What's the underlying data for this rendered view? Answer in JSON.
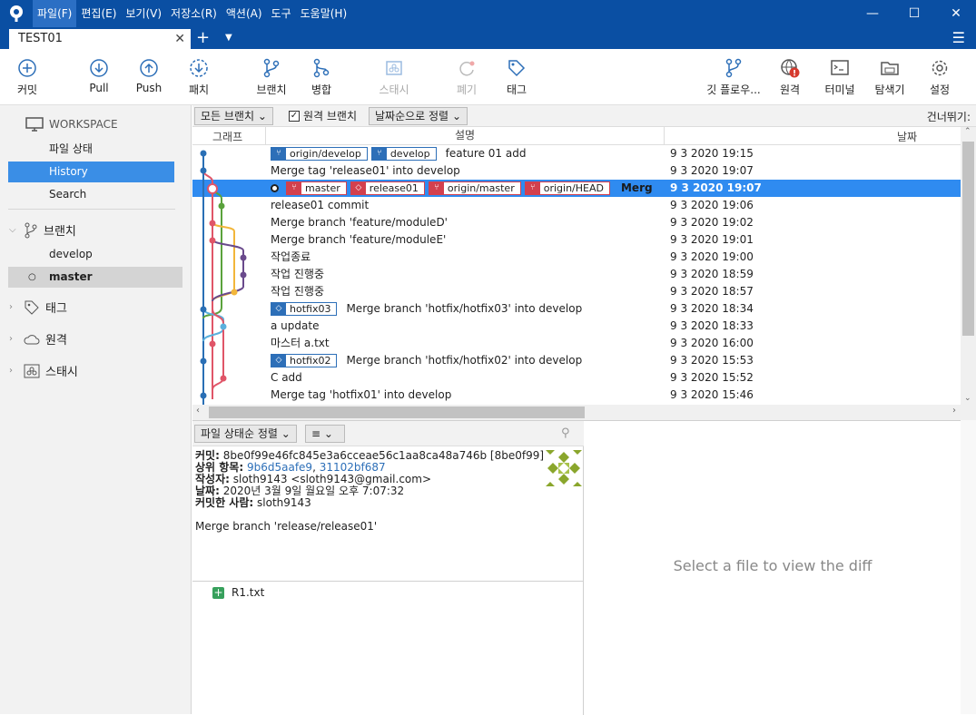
{
  "menu": {
    "items": [
      "파일(F)",
      "편집(E)",
      "보기(V)",
      "저장소(R)",
      "액션(A)",
      "도구",
      "도움말(H)"
    ]
  },
  "tab": {
    "title": "TEST01"
  },
  "toolbar": {
    "commit": "커밋",
    "pull": "Pull",
    "push": "Push",
    "fetch": "패치",
    "branch": "브랜치",
    "merge": "병합",
    "stash": "스태시",
    "discard": "폐기",
    "tag": "태그",
    "gitflow": "깃 플로우...",
    "remote": "원격",
    "terminal": "터미널",
    "explorer": "탐색기",
    "settings": "설정"
  },
  "sidebar": {
    "workspace": "WORKSPACE",
    "file_status": "파일 상태",
    "history": "History",
    "search": "Search",
    "branches": "브랜치",
    "branch_items": [
      "develop",
      "master"
    ],
    "tags": "태그",
    "remotes": "원격",
    "stashes": "스태시"
  },
  "filter": {
    "all_branches": "모든 브랜치",
    "remote_branches": "원격 브랜치",
    "sort": "날짜순으로 정렬",
    "skip": "건너뛰기:"
  },
  "columns": {
    "graph": "그래프",
    "desc": "설명",
    "date": "날짜"
  },
  "commits": [
    {
      "badges": [
        {
          "label": "origin/develop",
          "type": "branch",
          "color": "blue"
        },
        {
          "label": "develop",
          "type": "branch",
          "color": "blue"
        }
      ],
      "msg": "feature 01 add",
      "date": "9 3 2020 19:15"
    },
    {
      "badges": [],
      "msg": "Merge tag 'release01' into develop",
      "date": "9 3 2020 19:07"
    },
    {
      "badges": [
        {
          "label": "master",
          "type": "branch",
          "color": "red"
        },
        {
          "label": "release01",
          "type": "tag",
          "color": "red"
        },
        {
          "label": "origin/master",
          "type": "branch",
          "color": "red"
        },
        {
          "label": "origin/HEAD",
          "type": "branch",
          "color": "red"
        }
      ],
      "msg": "Merg",
      "date": "9 3 2020 19:07",
      "selected": true
    },
    {
      "badges": [],
      "msg": "release01 commit",
      "date": "9 3 2020 19:06"
    },
    {
      "badges": [],
      "msg": "Merge branch 'feature/moduleD'",
      "date": "9 3 2020 19:02"
    },
    {
      "badges": [],
      "msg": "Merge branch 'feature/moduleE'",
      "date": "9 3 2020 19:01"
    },
    {
      "badges": [],
      "msg": "작업종료",
      "date": "9 3 2020 19:00"
    },
    {
      "badges": [],
      "msg": "작업 진행중",
      "date": "9 3 2020 18:59"
    },
    {
      "badges": [],
      "msg": "작업 진행중",
      "date": "9 3 2020 18:57"
    },
    {
      "badges": [
        {
          "label": "hotfix03",
          "type": "tag",
          "color": "blue"
        }
      ],
      "msg": "Merge branch 'hotfix/hotfix03' into develop",
      "date": "9 3 2020 18:34"
    },
    {
      "badges": [],
      "msg": "a update",
      "date": "9 3 2020 18:33"
    },
    {
      "badges": [],
      "msg": "마스터 a.txt",
      "date": "9 3 2020 16:00"
    },
    {
      "badges": [
        {
          "label": "hotfix02",
          "type": "tag",
          "color": "blue"
        }
      ],
      "msg": "Merge branch 'hotfix/hotfix02' into develop",
      "date": "9 3 2020 15:53"
    },
    {
      "badges": [],
      "msg": "C add",
      "date": "9 3 2020 15:52"
    },
    {
      "badges": [],
      "msg": "Merge tag 'hotfix01' into develop",
      "date": "9 3 2020 15:46"
    }
  ],
  "details": {
    "sort": "파일 상태순 정렬",
    "commit_label": "커밋:",
    "commit_value": "8be0f99e46fc845e3a6cceae56c1aa8ca48a746b [8be0f99]",
    "parents_label": "상위 항목:",
    "parent1": "9b6d5aafe9",
    "parent_sep": ", ",
    "parent2": "31102bf687",
    "author_label": "작성자:",
    "author_value": "sloth9143 <sloth9143@gmail.com>",
    "date_label": "날짜:",
    "date_value": "2020년 3월 9일 월요일 오후 7:07:32",
    "committer_label": "커밋한 사람:",
    "committer_value": "sloth9143",
    "message": "Merge branch 'release/release01'",
    "file": "R1.txt"
  },
  "diff": {
    "placeholder": "Select a file to view the diff"
  },
  "colors": {
    "titlebar": "#0a4fa3",
    "selection": "#2f8bf0",
    "sidebar_sel": "#3a8ee6",
    "branch_badge": "#2d6fb8",
    "tag_badge": "#d2404e"
  }
}
